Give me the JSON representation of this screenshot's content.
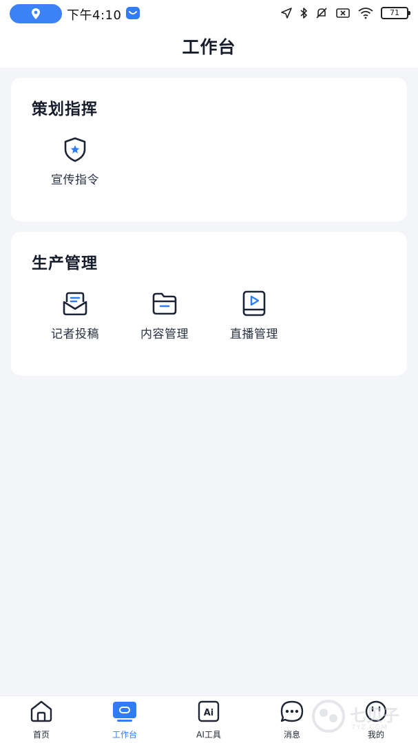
{
  "status_bar": {
    "time": "下午4:10",
    "battery": "71"
  },
  "header": {
    "title": "工作台"
  },
  "sections": [
    {
      "title": "策划指挥",
      "items": [
        {
          "label": "宣传指令",
          "icon": "shield-star-icon"
        }
      ]
    },
    {
      "title": "生产管理",
      "items": [
        {
          "label": "记者投稿",
          "icon": "inbox-mail-icon"
        },
        {
          "label": "内容管理",
          "icon": "folder-icon"
        },
        {
          "label": "直播管理",
          "icon": "tablet-play-icon"
        }
      ]
    }
  ],
  "tabbar": {
    "active_index": 1,
    "active_color": "#2f7cf6",
    "items": [
      {
        "label": "首页",
        "icon": "home-icon"
      },
      {
        "label": "工作台",
        "icon": "workbench-icon"
      },
      {
        "label": "AI工具",
        "icon": "ai-tool-icon"
      },
      {
        "label": "消息",
        "icon": "message-icon"
      },
      {
        "label": "我的",
        "icon": "profile-icon"
      }
    ]
  },
  "watermark": {
    "text": "七贝子",
    "sub": "7YZ.COM"
  },
  "colors": {
    "accent": "#2f7cf6",
    "background": "#f4f5f9",
    "card": "#ffffff"
  }
}
